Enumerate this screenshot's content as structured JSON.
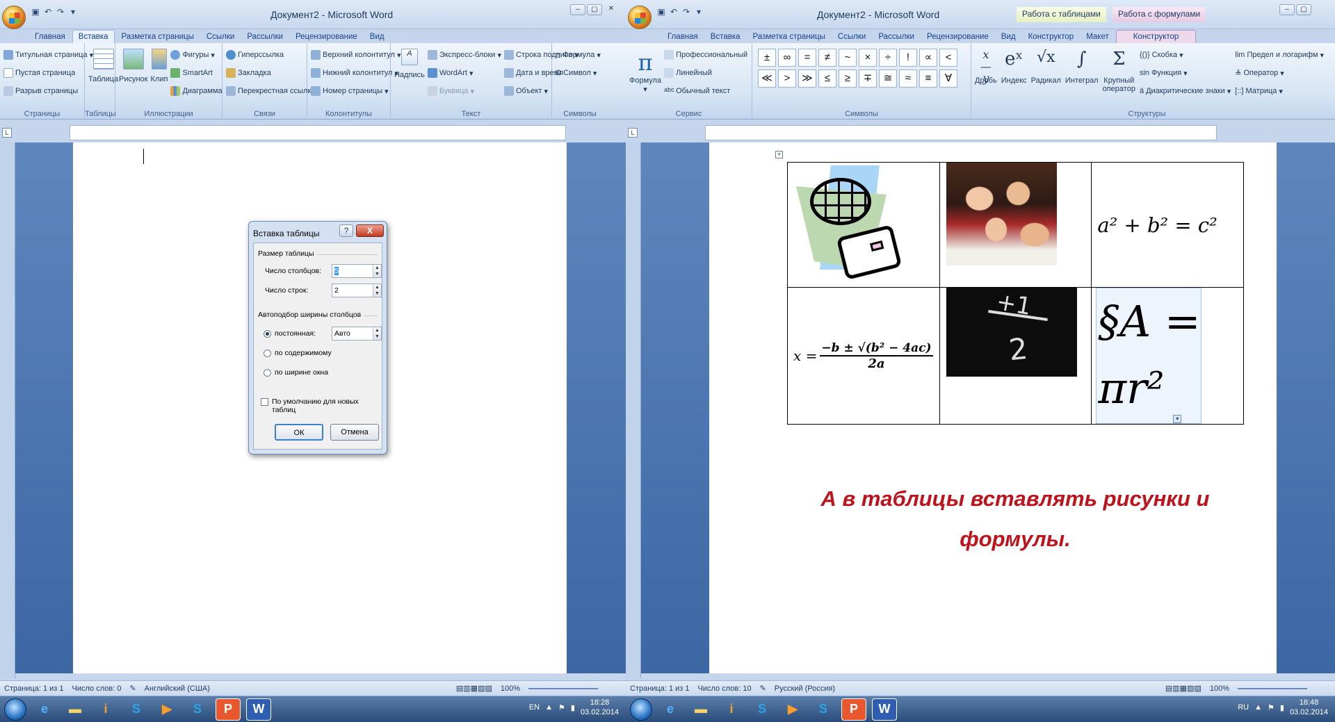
{
  "left": {
    "title": "Документ2 - Microsoft Word",
    "tabs": [
      "Главная",
      "Вставка",
      "Разметка страницы",
      "Ссылки",
      "Рассылки",
      "Рецензирование",
      "Вид"
    ],
    "active_tab": "Вставка",
    "ribbon": {
      "pages": {
        "items": [
          "Титульная страница",
          "Пустая страница",
          "Разрыв страницы"
        ],
        "name": "Страницы"
      },
      "tables": {
        "btn": "Таблица",
        "name": "Таблицы"
      },
      "illustrations": {
        "big": [
          "Рисунок",
          "Клип"
        ],
        "items": [
          "Фигуры",
          "SmartArt",
          "Диаграмма"
        ],
        "name": "Иллюстрации"
      },
      "links": {
        "items": [
          "Гиперссылка",
          "Закладка",
          "Перекрестная ссылка"
        ],
        "name": "Связи"
      },
      "headers": {
        "items": [
          "Верхний колонтитул",
          "Нижний колонтитул",
          "Номер страницы"
        ],
        "name": "Колонтитулы"
      },
      "text": {
        "big": "Надпись",
        "items": [
          "Экспресс-блоки",
          "WordArt",
          "Буквица",
          "Строка подписи",
          "Дата и время",
          "Объект"
        ],
        "name": "Текст"
      },
      "symbols": {
        "items": [
          "Формула",
          "Символ"
        ],
        "name": "Символы"
      }
    },
    "status": {
      "page": "Страница: 1 из 1",
      "words": "Число слов: 0",
      "lang": "Английский (США)",
      "zoom": "100%"
    },
    "dialog": {
      "title": "Вставка таблицы",
      "help": "?",
      "close": "X",
      "group_size": "Размер таблицы",
      "cols_label": "Число столбцов:",
      "cols_value": "5",
      "rows_label": "Число строк:",
      "rows_value": "2",
      "group_autofit": "Автоподбор ширины столбцов",
      "fixed": "постоянная:",
      "fixed_value": "Авто",
      "by_content": "по содержимому",
      "by_window": "по ширине окна",
      "default_chk": "По умолчанию для новых таблиц",
      "ok": "ОК",
      "cancel": "Отмена"
    },
    "tray": {
      "lang": "EN",
      "time": "18:28",
      "date": "03.02.2014"
    }
  },
  "right": {
    "title": "Документ2 - Microsoft Word",
    "ctx1": "Работа с таблицами",
    "ctx2": "Работа с формулами",
    "tabs": [
      "Главная",
      "Вставка",
      "Разметка страницы",
      "Ссылки",
      "Рассылки",
      "Рецензирование",
      "Вид",
      "Конструктор",
      "Макет",
      "Конструктор"
    ],
    "ribbon": {
      "service": {
        "formula": "Формула",
        "items": [
          "Профессиональный",
          "Линейный",
          "Обычный текст"
        ],
        "name": "Сервис"
      },
      "symbols": {
        "row1": [
          "±",
          "∞",
          "=",
          "≠",
          "~",
          "×",
          "÷",
          "!",
          "∝",
          "<"
        ],
        "row2": [
          "≪",
          ">",
          "≫",
          "≤",
          "≥",
          "∓",
          "≅",
          "≈",
          "≡",
          "∀"
        ],
        "name": "Символы"
      },
      "structures": {
        "big": [
          "Дробь",
          "Индекс",
          "Радикал",
          "Интеграл",
          "Крупный оператор"
        ],
        "items": [
          "Скобка",
          "Функция",
          "Диакритические знаки",
          "Предел и логарифм",
          "Оператор",
          "Матрица"
        ],
        "name": "Структуры"
      }
    },
    "doc": {
      "formula1": "a² + b² = c²",
      "formula2_left": "x =",
      "formula2_num": "−b ± √(b² − 4ac)",
      "formula2_den": "2a",
      "formula3_a": "§A =",
      "formula3_b": "πr²",
      "caption_line1": "А  в таблицы вставлять рисунки и",
      "caption_line2": "формулы."
    },
    "status": {
      "page": "Страница: 1 из 1",
      "words": "Число слов: 10",
      "lang": "Русский (Россия)",
      "zoom": "100%"
    },
    "tray": {
      "lang": "RU",
      "time": "18:48",
      "date": "03.02.2014"
    }
  }
}
